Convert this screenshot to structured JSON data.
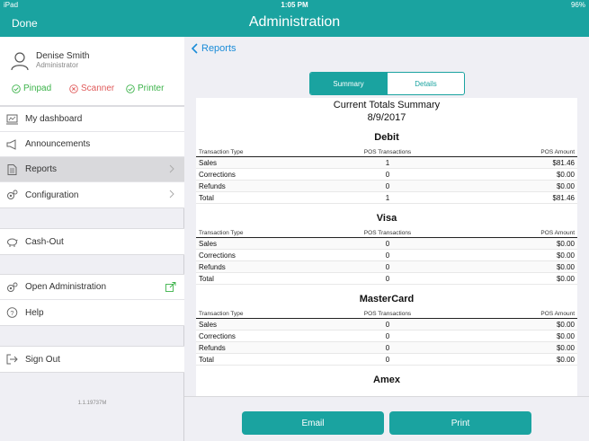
{
  "status_bar": {
    "device": "iPad",
    "time": "1:05 PM",
    "battery": "96%"
  },
  "nav": {
    "done_label": "Done",
    "title": "Administration"
  },
  "user": {
    "name": "Denise Smith",
    "role": "Administrator"
  },
  "devices": [
    {
      "label": "Pinpad",
      "status": "ok"
    },
    {
      "label": "Scanner",
      "status": "error"
    },
    {
      "label": "Printer",
      "status": "ok"
    }
  ],
  "menu_group_1": [
    {
      "label": "My dashboard"
    },
    {
      "label": "Announcements"
    },
    {
      "label": "Reports"
    },
    {
      "label": "Configuration"
    }
  ],
  "menu_group_2": [
    {
      "label": "Cash-Out"
    }
  ],
  "menu_group_3": [
    {
      "label": "Open Administration"
    },
    {
      "label": "Help"
    }
  ],
  "menu_group_4": [
    {
      "label": "Sign Out"
    }
  ],
  "version": "1.1.19737M",
  "main": {
    "back_label": "Reports",
    "tabs": [
      "Summary",
      "Details"
    ],
    "report_title": "Current Totals Summary",
    "report_date": "8/9/2017",
    "columns": [
      "Transaction Type",
      "POS Transactions",
      "POS Amount"
    ],
    "sections": [
      {
        "name": "Debit",
        "rows": [
          [
            "Sales",
            "1",
            "$81.46"
          ],
          [
            "Corrections",
            "0",
            "$0.00"
          ],
          [
            "Refunds",
            "0",
            "$0.00"
          ],
          [
            "Total",
            "1",
            "$81.46"
          ]
        ]
      },
      {
        "name": "Visa",
        "rows": [
          [
            "Sales",
            "0",
            "$0.00"
          ],
          [
            "Corrections",
            "0",
            "$0.00"
          ],
          [
            "Refunds",
            "0",
            "$0.00"
          ],
          [
            "Total",
            "0",
            "$0.00"
          ]
        ]
      },
      {
        "name": "MasterCard",
        "rows": [
          [
            "Sales",
            "0",
            "$0.00"
          ],
          [
            "Corrections",
            "0",
            "$0.00"
          ],
          [
            "Refunds",
            "0",
            "$0.00"
          ],
          [
            "Total",
            "0",
            "$0.00"
          ]
        ]
      },
      {
        "name": "Amex",
        "rows": []
      }
    ],
    "email_label": "Email",
    "print_label": "Print"
  },
  "colors": {
    "accent": "#1aa3a0",
    "link": "#1a8cd8",
    "ok": "#3cb34a",
    "error": "#e05b5b"
  }
}
